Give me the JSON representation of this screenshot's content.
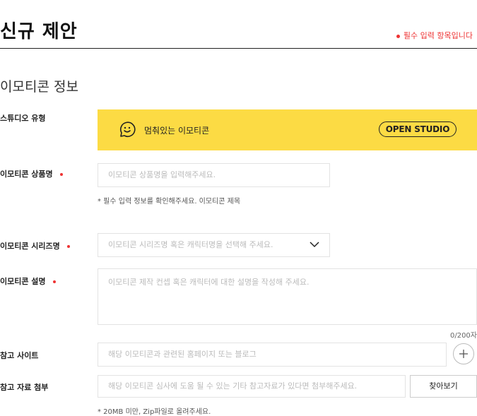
{
  "header": {
    "title": "신규 제안",
    "required_notice": "필수 입력 항목입니다"
  },
  "section": {
    "title": "이모티콘 정보"
  },
  "studio": {
    "label": "스튜디오 유형",
    "name": "멈춰있는 이모티콘",
    "badge": "OPEN STUDIO",
    "background_color": "#fcdb44"
  },
  "product_name": {
    "label": "이모티콘 상품명",
    "placeholder": "이모티콘 상품명을 입력해주세요.",
    "helper": "* 필수 입력 정보를 확인해주세요. 이모티콘 제목"
  },
  "series": {
    "label": "이모티콘 시리즈명",
    "placeholder": "이모티콘 시리즈명 혹은 캐릭터명을 선택해 주세요.",
    "icon": "chevron-down-icon"
  },
  "description": {
    "label": "이모티콘 설명",
    "placeholder": "이모티콘 제작 컨셉 혹은 캐릭터에 대한 설명을 작성해 주세요.",
    "char_count": "0/200자"
  },
  "reference_site": {
    "label": "참고 사이트",
    "placeholder": "해당 이모티콘과 관련된 홈페이지 또는 블로그",
    "icon": "plus-icon"
  },
  "attachment": {
    "label": "참고 자료 첨부",
    "placeholder": "해당 이모티콘 심사에 도움 될 수 있는 기타 참고자료가 있다면 첨부해주세요.",
    "button": "찾아보기",
    "helper": "* 20MB 미만, Zip파일로 올려주세요."
  },
  "colors": {
    "required": "#e33333",
    "accent": "#fcdb44"
  }
}
